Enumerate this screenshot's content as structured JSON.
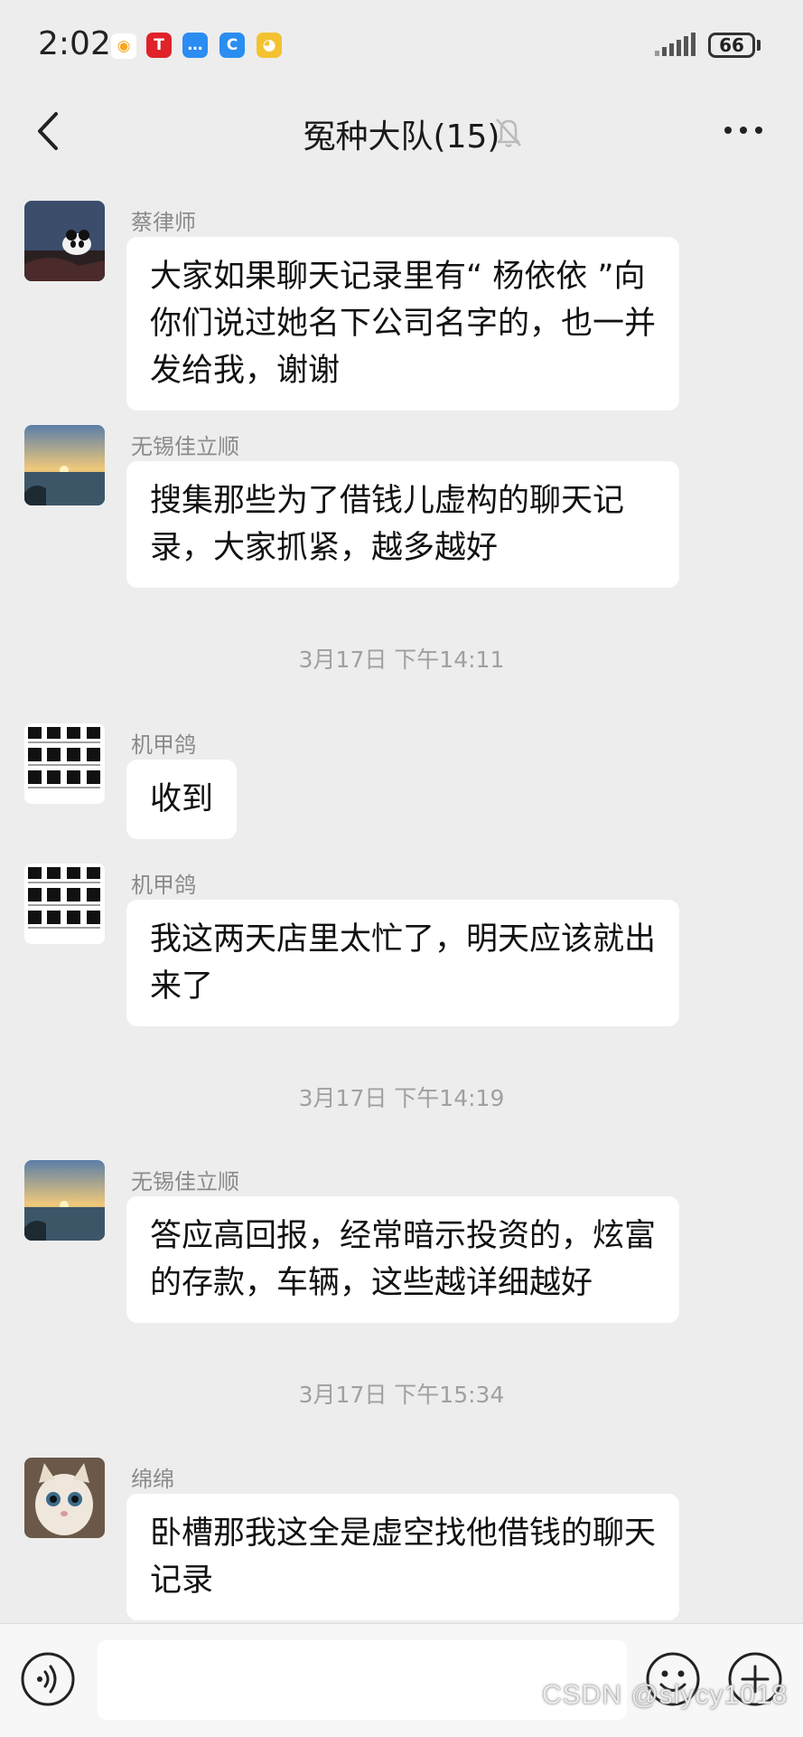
{
  "status_bar": {
    "time": "2:02",
    "battery": "66",
    "apps": [
      {
        "icon": "weibo-icon",
        "color": "#f5a623",
        "glyph": "微"
      },
      {
        "icon": "tesla-icon",
        "color": "#e0222a",
        "glyph": "T"
      },
      {
        "icon": "message-icon",
        "color": "#2b8cf2",
        "glyph": "…"
      },
      {
        "icon": "wallet-icon",
        "color": "#2a8ef0",
        "glyph": "C"
      },
      {
        "icon": "assistant-icon",
        "color": "#f2c230",
        "glyph": "◕"
      }
    ]
  },
  "header": {
    "title": "冤种大队(15)"
  },
  "messages": [
    {
      "type": "message",
      "sender": "蔡律师",
      "avatar": "panda",
      "text": "大家如果聊天记录里有“ 杨依依 ”向你们说过她名下公司名字的，也一并发给我，谢谢"
    },
    {
      "type": "message",
      "sender": "无锡佳立顺",
      "avatar": "sunset",
      "text": "搜集那些为了借钱儿虚构的聊天记录，大家抓紧，越多越好"
    },
    {
      "type": "time",
      "text": "3月17日 下午14:11"
    },
    {
      "type": "message",
      "sender": "机甲鸽",
      "avatar": "icons",
      "text": "收到"
    },
    {
      "type": "message",
      "sender": "机甲鸽",
      "avatar": "icons",
      "text": "我这两天店里太忙了，明天应该就出来了"
    },
    {
      "type": "time",
      "text": "3月17日 下午14:19"
    },
    {
      "type": "message",
      "sender": "无锡佳立顺",
      "avatar": "sunset",
      "text": "答应高回报，经常暗示投资的，炫富的存款，车辆，这些越详细越好"
    },
    {
      "type": "time",
      "text": "3月17日 下午15:34"
    },
    {
      "type": "message",
      "sender": "绵绵",
      "avatar": "cat",
      "text": "卧槽那我这全是虚空找他借钱的聊天记录"
    }
  ],
  "input": {
    "placeholder": ""
  },
  "watermark": "CSDN @slycy1018"
}
